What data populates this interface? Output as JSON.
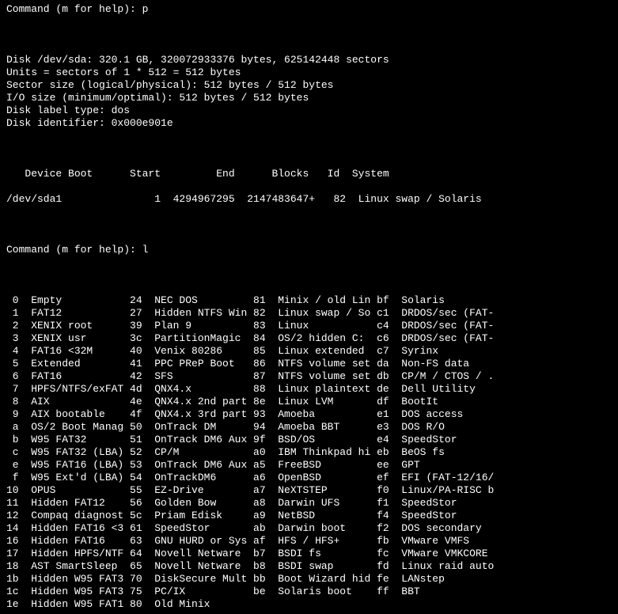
{
  "prompt1": {
    "text": "Command (m for help): ",
    "input": "p"
  },
  "diskinfo": [
    "Disk /dev/sda: 320.1 GB, 320072933376 bytes, 625142448 sectors",
    "Units = sectors of 1 * 512 = 512 bytes",
    "Sector size (logical/physical): 512 bytes / 512 bytes",
    "I/O size (minimum/optimal): 512 bytes / 512 bytes",
    "Disk label type: dos",
    "Disk identifier: 0x000e901e"
  ],
  "part_header": {
    "device": "Device",
    "boot": "Boot",
    "start": "Start",
    "end": "End",
    "blocks": "Blocks",
    "id": "Id",
    "system": "System"
  },
  "partitions": [
    {
      "device": "/dev/sda1",
      "boot": "",
      "start": "1",
      "end": "4294967295",
      "blocks": "2147483647+",
      "id": "82",
      "system": "Linux swap / Solaris"
    }
  ],
  "prompt2": {
    "text": "Command (m for help): ",
    "input": "l"
  },
  "types": [
    {
      "c1": " 0",
      "n1": "Empty",
      "c2": "24",
      "n2": "NEC DOS",
      "c3": "81",
      "n3": "Minix / old Lin",
      "c4": "bf",
      "n4": "Solaris"
    },
    {
      "c1": " 1",
      "n1": "FAT12",
      "c2": "27",
      "n2": "Hidden NTFS Win",
      "c3": "82",
      "n3": "Linux swap / So",
      "c4": "c1",
      "n4": "DRDOS/sec (FAT-"
    },
    {
      "c1": " 2",
      "n1": "XENIX root",
      "c2": "39",
      "n2": "Plan 9",
      "c3": "83",
      "n3": "Linux",
      "c4": "c4",
      "n4": "DRDOS/sec (FAT-"
    },
    {
      "c1": " 3",
      "n1": "XENIX usr",
      "c2": "3c",
      "n2": "PartitionMagic",
      "c3": "84",
      "n3": "OS/2 hidden C:",
      "c4": "c6",
      "n4": "DRDOS/sec (FAT-"
    },
    {
      "c1": " 4",
      "n1": "FAT16 <32M",
      "c2": "40",
      "n2": "Venix 80286",
      "c3": "85",
      "n3": "Linux extended",
      "c4": "c7",
      "n4": "Syrinx"
    },
    {
      "c1": " 5",
      "n1": "Extended",
      "c2": "41",
      "n2": "PPC PReP Boot",
      "c3": "86",
      "n3": "NTFS volume set",
      "c4": "da",
      "n4": "Non-FS data"
    },
    {
      "c1": " 6",
      "n1": "FAT16",
      "c2": "42",
      "n2": "SFS",
      "c3": "87",
      "n3": "NTFS volume set",
      "c4": "db",
      "n4": "CP/M / CTOS / ."
    },
    {
      "c1": " 7",
      "n1": "HPFS/NTFS/exFAT",
      "c2": "4d",
      "n2": "QNX4.x",
      "c3": "88",
      "n3": "Linux plaintext",
      "c4": "de",
      "n4": "Dell Utility"
    },
    {
      "c1": " 8",
      "n1": "AIX",
      "c2": "4e",
      "n2": "QNX4.x 2nd part",
      "c3": "8e",
      "n3": "Linux LVM",
      "c4": "df",
      "n4": "BootIt"
    },
    {
      "c1": " 9",
      "n1": "AIX bootable",
      "c2": "4f",
      "n2": "QNX4.x 3rd part",
      "c3": "93",
      "n3": "Amoeba",
      "c4": "e1",
      "n4": "DOS access"
    },
    {
      "c1": " a",
      "n1": "OS/2 Boot Manag",
      "c2": "50",
      "n2": "OnTrack DM",
      "c3": "94",
      "n3": "Amoeba BBT",
      "c4": "e3",
      "n4": "DOS R/O"
    },
    {
      "c1": " b",
      "n1": "W95 FAT32",
      "c2": "51",
      "n2": "OnTrack DM6 Aux",
      "c3": "9f",
      "n3": "BSD/OS",
      "c4": "e4",
      "n4": "SpeedStor"
    },
    {
      "c1": " c",
      "n1": "W95 FAT32 (LBA)",
      "c2": "52",
      "n2": "CP/M",
      "c3": "a0",
      "n3": "IBM Thinkpad hi",
      "c4": "eb",
      "n4": "BeOS fs"
    },
    {
      "c1": " e",
      "n1": "W95 FAT16 (LBA)",
      "c2": "53",
      "n2": "OnTrack DM6 Aux",
      "c3": "a5",
      "n3": "FreeBSD",
      "c4": "ee",
      "n4": "GPT"
    },
    {
      "c1": " f",
      "n1": "W95 Ext'd (LBA)",
      "c2": "54",
      "n2": "OnTrackDM6",
      "c3": "a6",
      "n3": "OpenBSD",
      "c4": "ef",
      "n4": "EFI (FAT-12/16/"
    },
    {
      "c1": "10",
      "n1": "OPUS",
      "c2": "55",
      "n2": "EZ-Drive",
      "c3": "a7",
      "n3": "NeXTSTEP",
      "c4": "f0",
      "n4": "Linux/PA-RISC b"
    },
    {
      "c1": "11",
      "n1": "Hidden FAT12",
      "c2": "56",
      "n2": "Golden Bow",
      "c3": "a8",
      "n3": "Darwin UFS",
      "c4": "f1",
      "n4": "SpeedStor"
    },
    {
      "c1": "12",
      "n1": "Compaq diagnost",
      "c2": "5c",
      "n2": "Priam Edisk",
      "c3": "a9",
      "n3": "NetBSD",
      "c4": "f4",
      "n4": "SpeedStor"
    },
    {
      "c1": "14",
      "n1": "Hidden FAT16 <3",
      "c2": "61",
      "n2": "SpeedStor",
      "c3": "ab",
      "n3": "Darwin boot",
      "c4": "f2",
      "n4": "DOS secondary"
    },
    {
      "c1": "16",
      "n1": "Hidden FAT16",
      "c2": "63",
      "n2": "GNU HURD or Sys",
      "c3": "af",
      "n3": "HFS / HFS+",
      "c4": "fb",
      "n4": "VMware VMFS"
    },
    {
      "c1": "17",
      "n1": "Hidden HPFS/NTF",
      "c2": "64",
      "n2": "Novell Netware",
      "c3": "b7",
      "n3": "BSDI fs",
      "c4": "fc",
      "n4": "VMware VMKCORE"
    },
    {
      "c1": "18",
      "n1": "AST SmartSleep",
      "c2": "65",
      "n2": "Novell Netware",
      "c3": "b8",
      "n3": "BSDI swap",
      "c4": "fd",
      "n4": "Linux raid auto"
    },
    {
      "c1": "1b",
      "n1": "Hidden W95 FAT3",
      "c2": "70",
      "n2": "DiskSecure Mult",
      "c3": "bb",
      "n3": "Boot Wizard hid",
      "c4": "fe",
      "n4": "LANstep"
    },
    {
      "c1": "1c",
      "n1": "Hidden W95 FAT3",
      "c2": "75",
      "n2": "PC/IX",
      "c3": "be",
      "n3": "Solaris boot",
      "c4": "ff",
      "n4": "BBT"
    },
    {
      "c1": "1e",
      "n1": "Hidden W95 FAT1",
      "c2": "80",
      "n2": "Old Minix",
      "c3": "",
      "n3": "",
      "c4": "",
      "n4": ""
    }
  ]
}
